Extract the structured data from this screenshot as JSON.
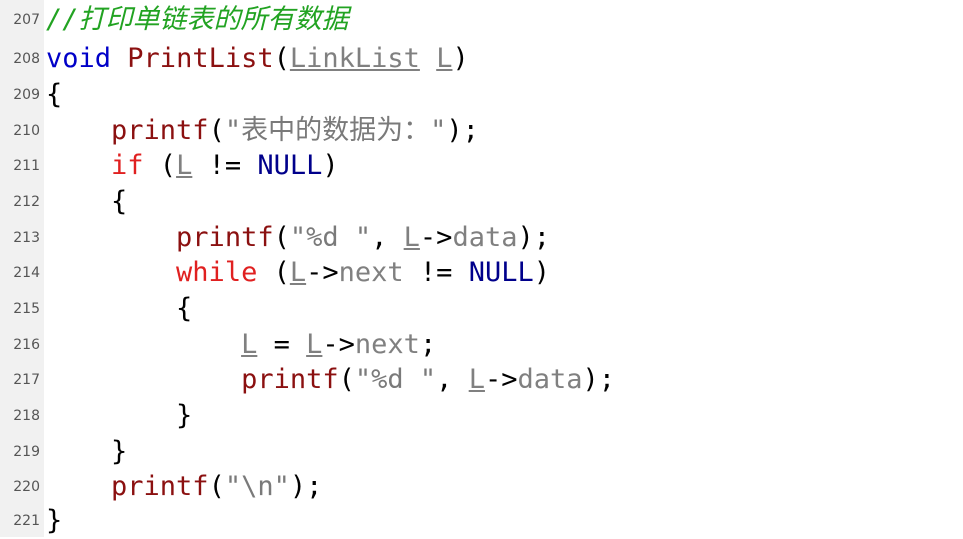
{
  "editor": {
    "lines": [
      {
        "num": "207",
        "tokens": {
          "a": "//打印单链表的所有数据"
        }
      },
      {
        "num": "208",
        "tokens": {
          "a": "void",
          "b": " ",
          "c": "PrintList",
          "d": "(",
          "e": "LinkList",
          "f": " ",
          "g": "L",
          "h": ")"
        }
      },
      {
        "num": "209",
        "tokens": {
          "a": "{"
        }
      },
      {
        "num": "210",
        "tokens": {
          "a": "    ",
          "b": "printf",
          "c": "(",
          "d": "\"表中的数据为：\"",
          "e": ");"
        }
      },
      {
        "num": "211",
        "tokens": {
          "a": "    ",
          "b": "if",
          "c": " (",
          "d": "L",
          "e": " != ",
          "f": "NULL",
          "g": ")"
        }
      },
      {
        "num": "212",
        "tokens": {
          "a": "    {"
        }
      },
      {
        "num": "213",
        "tokens": {
          "a": "        ",
          "b": "printf",
          "c": "(",
          "d": "\"%d \"",
          "e": ", ",
          "f": "L",
          "g": "->",
          "h": "data",
          "i": ");"
        }
      },
      {
        "num": "214",
        "tokens": {
          "a": "        ",
          "b": "while",
          "c": " (",
          "d": "L",
          "e": "->",
          "f": "next",
          "g": " != ",
          "h": "NULL",
          "i": ")"
        }
      },
      {
        "num": "215",
        "tokens": {
          "a": "        {"
        }
      },
      {
        "num": "216",
        "tokens": {
          "a": "            ",
          "b": "L",
          "c": " = ",
          "d": "L",
          "e": "->",
          "f": "next",
          "g": ";"
        }
      },
      {
        "num": "217",
        "tokens": {
          "a": "            ",
          "b": "printf",
          "c": "(",
          "d": "\"%d \"",
          "e": ", ",
          "f": "L",
          "g": "->",
          "h": "data",
          "i": ");"
        }
      },
      {
        "num": "218",
        "tokens": {
          "a": "        }"
        }
      },
      {
        "num": "219",
        "tokens": {
          "a": "    }"
        }
      },
      {
        "num": "220",
        "tokens": {
          "a": "    ",
          "b": "printf",
          "c": "(",
          "d": "\"\\n\"",
          "e": ");"
        }
      },
      {
        "num": "221",
        "tokens": {
          "a": "}"
        }
      }
    ]
  },
  "colors": {
    "comment": "#22a322",
    "keyword": "#0000c8",
    "function": "#8b1010",
    "control": "#e02020",
    "string": "#7a7a7a",
    "macro": "#00008b",
    "gutter": "#f1f1f1"
  }
}
